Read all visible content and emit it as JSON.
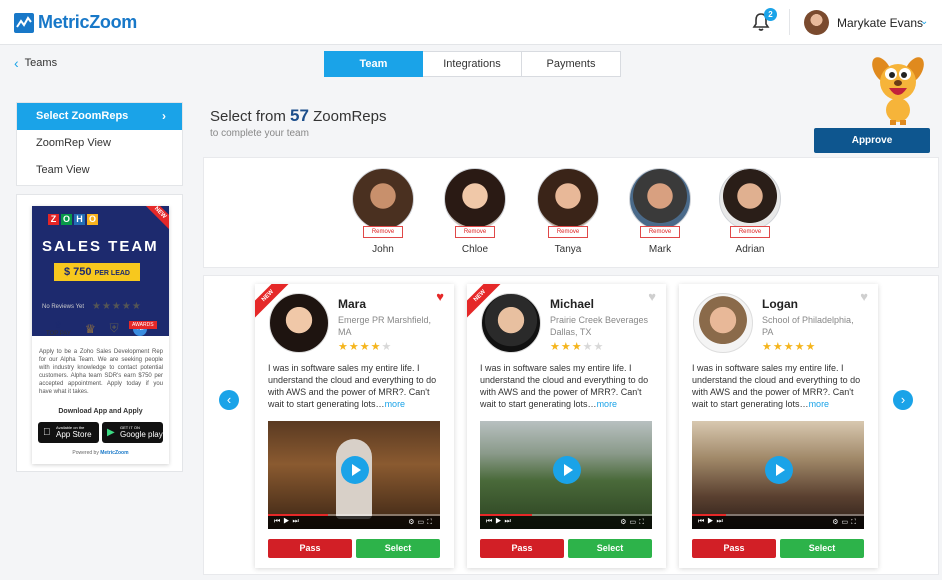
{
  "header": {
    "logo_text": "MetricZoom",
    "notification_count": "2",
    "user_name": "Marykate Evans"
  },
  "subheader": {
    "back_label": "Teams",
    "tabs": [
      {
        "label": "Team",
        "active": true
      },
      {
        "label": "Integrations",
        "active": false
      },
      {
        "label": "Payments",
        "active": false
      }
    ]
  },
  "sidebar": {
    "items": [
      {
        "label": "Select ZoomReps",
        "active": true
      },
      {
        "label": "ZoomRep View",
        "active": false
      },
      {
        "label": "Team View",
        "active": false
      }
    ]
  },
  "ad": {
    "brand_letters": [
      "Z",
      "O",
      "H",
      "O"
    ],
    "ribbon": "NEW",
    "title": "SALES TEAM",
    "price": "$ 750",
    "price_unit": "PER LEAD",
    "reviews": "No Reviews Yet",
    "award_1": "TOP PAY",
    "award_tag": "AWARDS",
    "award_extra": "+2",
    "body": "Apply to be a Zoho Sales Development Rep for our Alpha Team. We are seeking people with industry knowledge to contact potential customers. Alpha team SDR's earn $750 per accepted appointment. Apply today if you have what it takes.",
    "download_label": "Download App and Apply",
    "appstore_small": "Available on the",
    "appstore_big": "App Store",
    "play_small": "GET IT ON",
    "play_big": "Google play",
    "powered_label": "Powered by",
    "powered_brand": "MetricZoom"
  },
  "main": {
    "title_prefix": "Select from",
    "count": "57",
    "title_suffix": "ZoomReps",
    "subtitle": "to complete your team",
    "approve_label": "Approve"
  },
  "selected": {
    "remove_label": "Remove",
    "reps": [
      {
        "name": "John"
      },
      {
        "name": "Chloe"
      },
      {
        "name": "Tanya"
      },
      {
        "name": "Mark"
      },
      {
        "name": "Adrian"
      }
    ]
  },
  "cards": [
    {
      "name": "Mara",
      "org": "Emerge PR Marshfield, MA",
      "rating": 4,
      "is_new": true,
      "favorited": true,
      "bio": "I was in software sales my entire life. I understand the cloud and everything to do with AWS and the power of MRR?. Can't wait to start generating lots…",
      "more": "more",
      "pass": "Pass",
      "select": "Select",
      "progress": 0.35
    },
    {
      "name": "Michael",
      "org": "Prairie Creek Beverages Dallas, TX",
      "rating": 3,
      "is_new": true,
      "favorited": false,
      "bio": "I was in software sales my entire life. I understand the cloud and everything to do with AWS and the power of MRR?. Can't wait to start generating lots…",
      "more": "more",
      "pass": "Pass",
      "select": "Select",
      "progress": 0.3
    },
    {
      "name": "Logan",
      "org": "School of Philadelphia, PA",
      "rating": 5,
      "is_new": false,
      "favorited": false,
      "bio": "I was in software sales my entire life. I understand the cloud and everything to do with AWS and the power of MRR?. Can't wait to start generating lots…",
      "more": "more",
      "pass": "Pass",
      "select": "Select",
      "progress": 0.2
    }
  ],
  "colors": {
    "accent": "#1aa3e8",
    "brand": "#1878c8",
    "approve": "#0e568f",
    "pass": "#d21f26",
    "select": "#2db34a",
    "new_ribbon": "#e52828",
    "star": "#f5b51d"
  }
}
